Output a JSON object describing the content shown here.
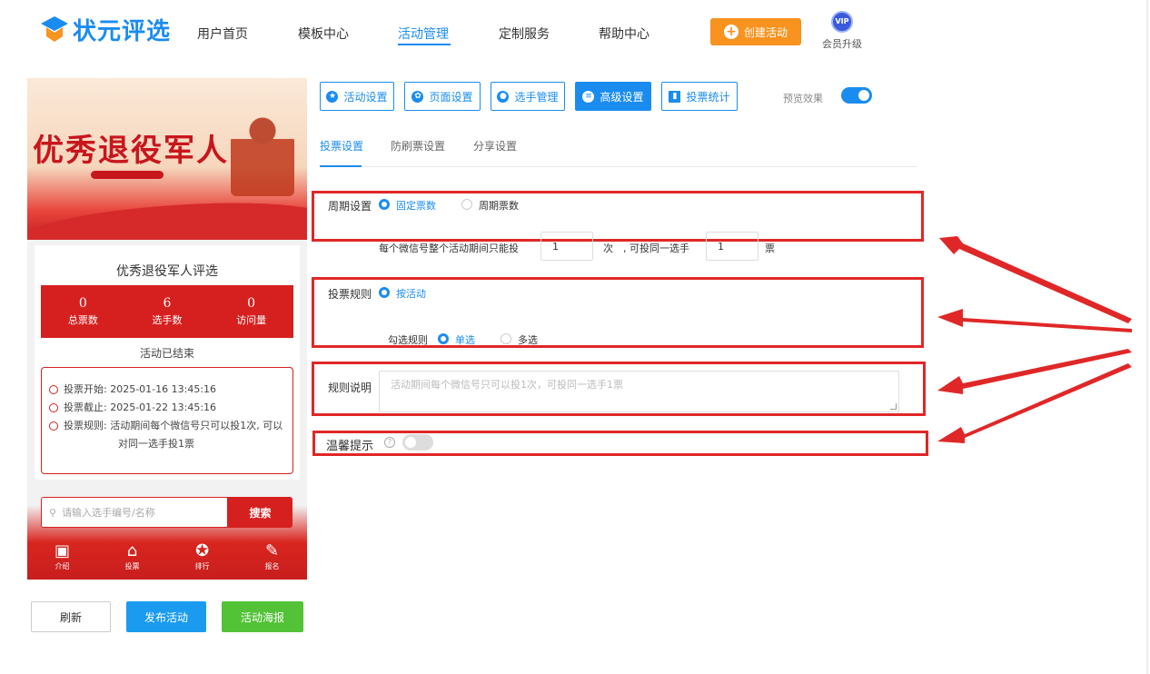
{
  "header": {
    "logo_text": "状元评选",
    "nav": [
      "用户首页",
      "模板中心",
      "活动管理",
      "定制服务",
      "帮助中心"
    ],
    "create_label": "创建活动",
    "vip_badge": "VIP",
    "vip_label": "会员升级"
  },
  "preview": {
    "banner_title": "优秀退役军人",
    "card_title": "优秀退役军人评选",
    "stats": [
      {
        "value": "0",
        "label": "总票数"
      },
      {
        "value": "6",
        "label": "选手数"
      },
      {
        "value": "0",
        "label": "访问量"
      }
    ],
    "status": "活动已结束",
    "start": "投票开始: 2025-01-16 13:45:16",
    "end": "投票截止: 2025-01-22 13:45:16",
    "rule_line1": "投票规则: 活动期间每个微信号只可以投1次, 可以",
    "rule_line2": "对同一选手投1票",
    "search_placeholder": "请输入选手编号/名称",
    "search_button": "搜索",
    "tabs": [
      {
        "label": "介绍",
        "icon": "book-icon"
      },
      {
        "label": "投票",
        "icon": "home-icon"
      },
      {
        "label": "排行",
        "icon": "badge-icon"
      },
      {
        "label": "报名",
        "icon": "edit-icon"
      }
    ]
  },
  "footer_buttons": {
    "refresh": "刷新",
    "publish": "发布活动",
    "poster": "活动海报"
  },
  "toolbar": {
    "buttons": [
      "活动设置",
      "页面设置",
      "选手管理",
      "高级设置",
      "投票统计"
    ],
    "preview_label": "预览效果"
  },
  "subtabs": [
    "投票设置",
    "防刷票设置",
    "分享设置"
  ],
  "form": {
    "period_label": "周期设置",
    "period_options": [
      "固定票数",
      "周期票数"
    ],
    "per_wechat_text": "每个微信号整个活动期间只能投",
    "times_value": "1",
    "times_unit": "次",
    "same_player_text": ", 可投同一选手",
    "votes_value": "1",
    "votes_unit": "票",
    "rule_label": "投票规则",
    "rule_option": "按活动",
    "check_rule_label": "勾选规则",
    "check_options": [
      "单选",
      "多选"
    ],
    "desc_label": "规则说明",
    "desc_placeholder": "活动期间每个微信号只可以投1次，可投同一选手1票",
    "tip_label": "温馨提示"
  },
  "colors": {
    "accent": "#1a8cf0",
    "highlight": "#e02727",
    "orange": "#f7931e",
    "green": "#52c236"
  }
}
